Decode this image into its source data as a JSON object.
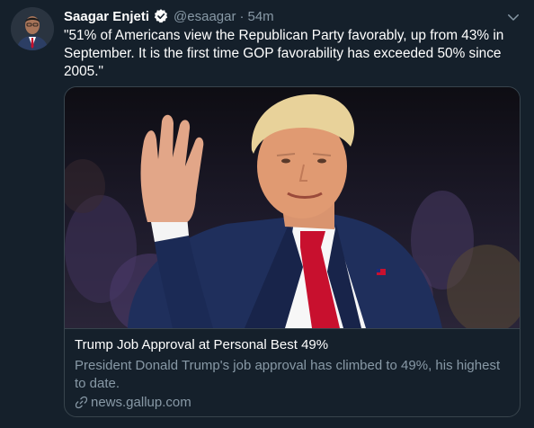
{
  "tweet": {
    "author_name": "Saagar Enjeti",
    "handle": "@esaagar",
    "separator": "·",
    "time": "54m",
    "text": "\"51% of Americans view the Republican Party favorably, up from 43% in September. It is the first time GOP favorability has exceeded 50% since 2005.\"",
    "icons": {
      "verified": "verified-badge-icon",
      "menu": "chevron-down-icon",
      "link": "link-icon"
    }
  },
  "card": {
    "title": "Trump Job Approval at Personal Best 49%",
    "description": "President Donald Trump's job approval has climbed to 49%, his highest to date.",
    "domain": "news.gallup.com"
  },
  "colors": {
    "background": "#15202b",
    "secondary_text": "#8899a6",
    "border": "#38444d",
    "verified_blue": "#ffffff",
    "tie_red": "#c8102e",
    "suit_navy": "#1f2f5c"
  }
}
